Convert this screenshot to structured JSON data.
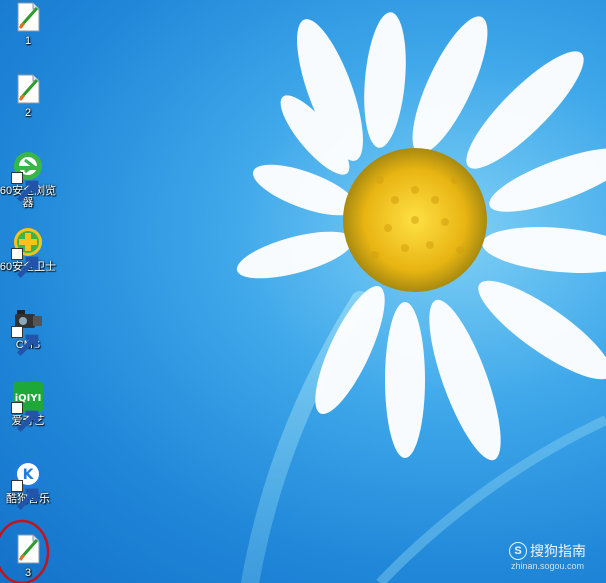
{
  "desktop": {
    "icons": [
      {
        "label": "1",
        "icon": "paint-document-icon"
      },
      {
        "label": "2",
        "icon": "paint-document-icon"
      },
      {
        "label": "60安全浏览\n器",
        "icon": "360-browser-icon"
      },
      {
        "label": "60安全卫士",
        "icon": "360-security-icon"
      },
      {
        "label": "CMS",
        "icon": "camera-icon"
      },
      {
        "label": "爱奇艺",
        "icon": "iqiyi-icon"
      },
      {
        "label": "酷狗音乐",
        "icon": "kugou-icon"
      },
      {
        "label": "3",
        "icon": "paint-document-icon"
      }
    ]
  },
  "watermark": {
    "brand": "搜狗指南",
    "logo_letter": "S",
    "url": "zhinan.sogou.com"
  },
  "colors": {
    "sky": "#2a92e0",
    "annotation_circle": "#c0151b",
    "petal": "#ffffff",
    "flower_center": "#f2c21a"
  }
}
